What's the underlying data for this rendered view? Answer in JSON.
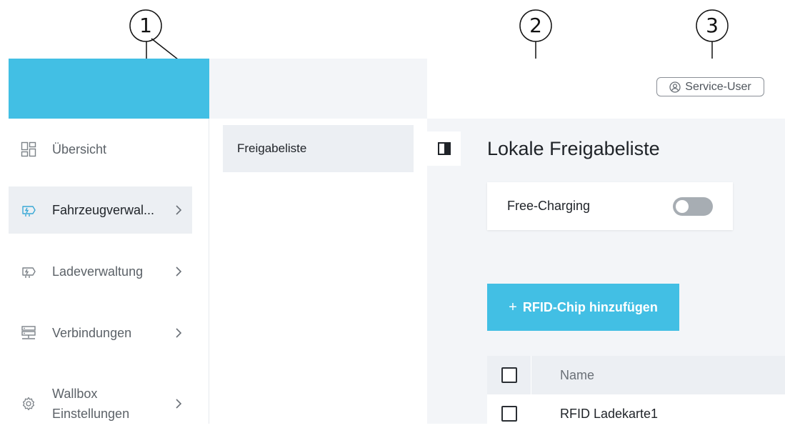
{
  "callouts": [
    "1",
    "2",
    "3"
  ],
  "header": {
    "user_label": "Service-User"
  },
  "sidebar": {
    "items": [
      {
        "label": "Übersicht",
        "icon": "dashboard-icon",
        "active": false,
        "has_chevron": false
      },
      {
        "label": "Fahrzeugverwal...",
        "icon": "charging-plug-icon",
        "active": true,
        "has_chevron": true
      },
      {
        "label": "Ladeverwaltung",
        "icon": "charging-plug-icon",
        "active": false,
        "has_chevron": true
      },
      {
        "label": "Verbindungen",
        "icon": "network-icon",
        "active": false,
        "has_chevron": true
      },
      {
        "label": "Wallbox Einstellungen",
        "label_line1": "Wallbox",
        "label_line2": "Einstellungen",
        "icon": "gear-icon",
        "active": false,
        "has_chevron": true
      }
    ]
  },
  "subnav": {
    "items": [
      {
        "label": "Freigabeliste",
        "active": true
      }
    ]
  },
  "main": {
    "title": "Lokale Freigabeliste",
    "free_charging": {
      "label": "Free-Charging",
      "enabled": false
    },
    "add_button": {
      "plus": "+",
      "label": "RFID-Chip hinzufügen"
    },
    "table": {
      "header": "Name",
      "rows": [
        {
          "name": "RFID Ladekarte1",
          "checked": false
        }
      ]
    }
  },
  "colors": {
    "accent": "#42bfe4",
    "active_bg": "#eceff3",
    "content_bg": "#f3f5f8",
    "toggle_off": "#a7adb3"
  }
}
